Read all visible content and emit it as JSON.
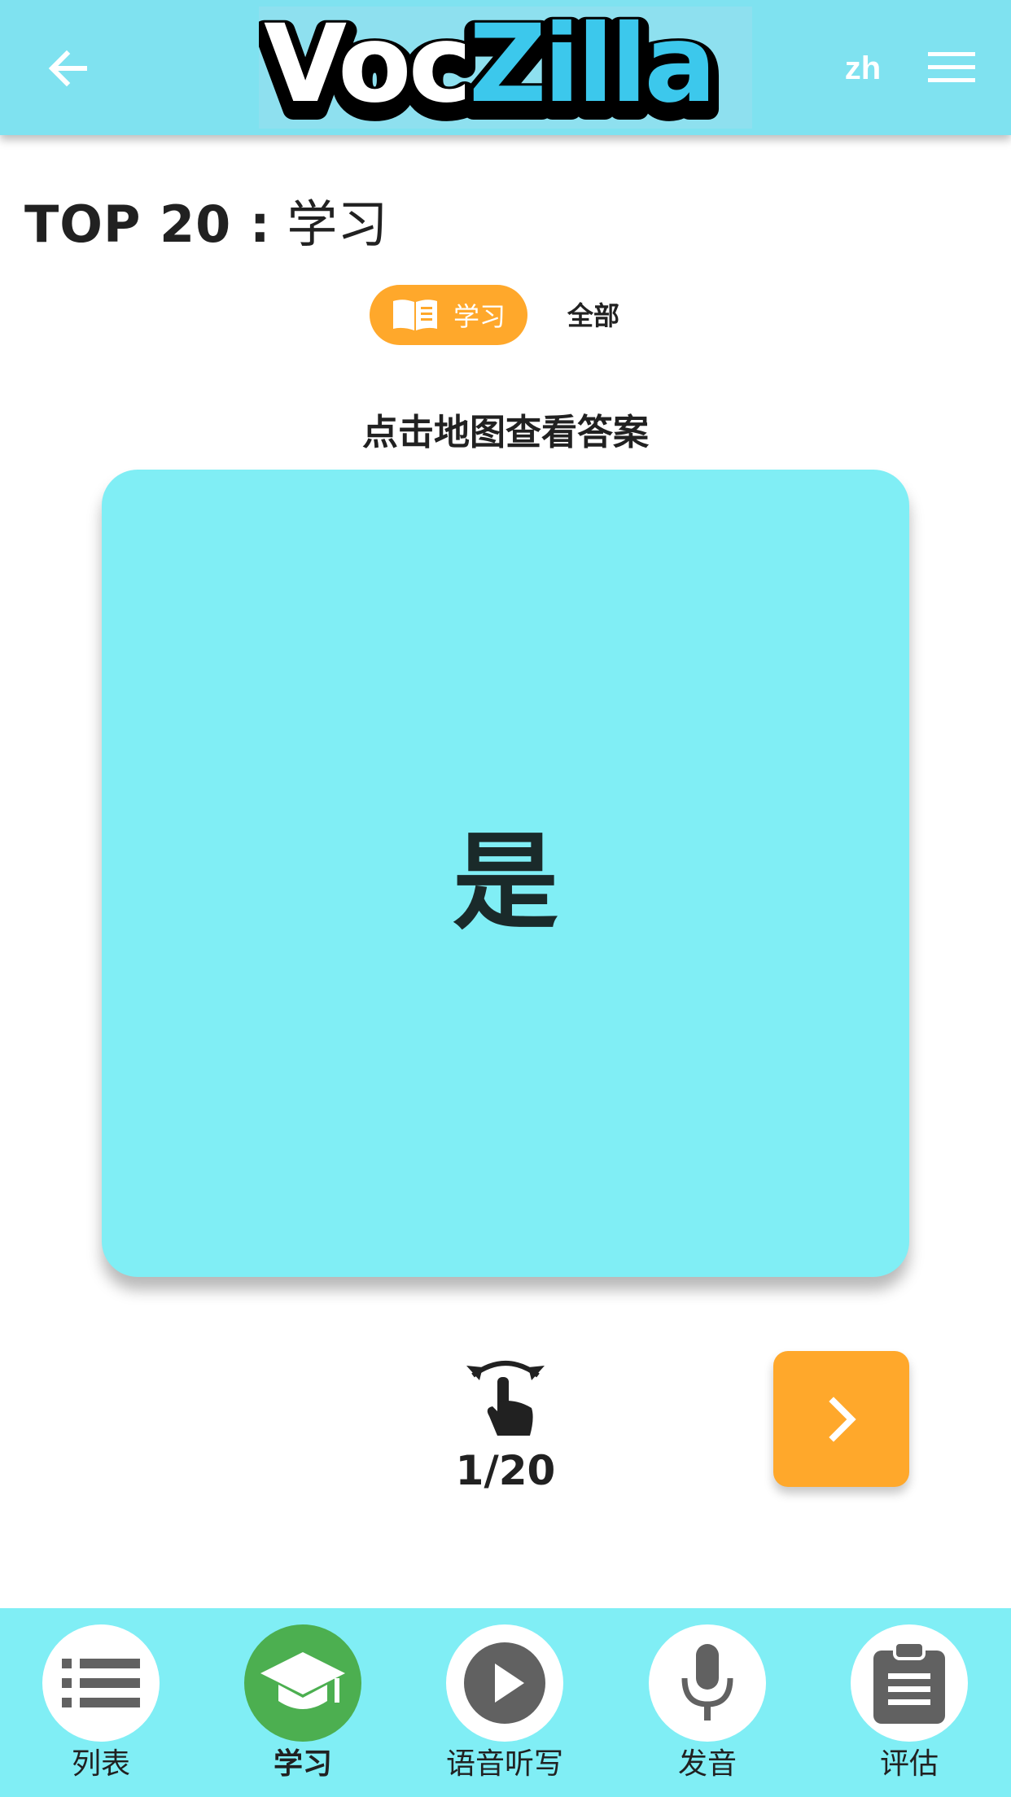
{
  "header": {
    "logo_part1": "Voc",
    "logo_part2": "Zilla",
    "language": "zh",
    "icons": {
      "back": "arrow-left-icon",
      "menu": "hamburger-menu-icon"
    }
  },
  "title": {
    "top": "TOP 20 :",
    "sub": "学习"
  },
  "mode": {
    "learn_label": "学习",
    "all_label": "全部",
    "learn_icon": "book-icon"
  },
  "hint": "点击地图查看答案",
  "card": {
    "word": "是"
  },
  "counter": "1/20",
  "next_icon": "chevron-right-icon",
  "flip_icon": "tap-rotate-icon",
  "bottom_nav": [
    {
      "label": "列表",
      "icon": "list-icon",
      "active": false
    },
    {
      "label": "学习",
      "icon": "graduation-cap-icon",
      "active": true
    },
    {
      "label": "语音听写",
      "icon": "play-icon",
      "active": false
    },
    {
      "label": "发音",
      "icon": "microphone-icon",
      "active": false
    },
    {
      "label": "评估",
      "icon": "clipboard-icon",
      "active": false
    }
  ],
  "colors": {
    "header": "#7fe2f0",
    "card": "#80eef5",
    "accent": "#ffa82b",
    "active_nav": "#4caf50",
    "logo_blue": "#3cc8ec"
  }
}
